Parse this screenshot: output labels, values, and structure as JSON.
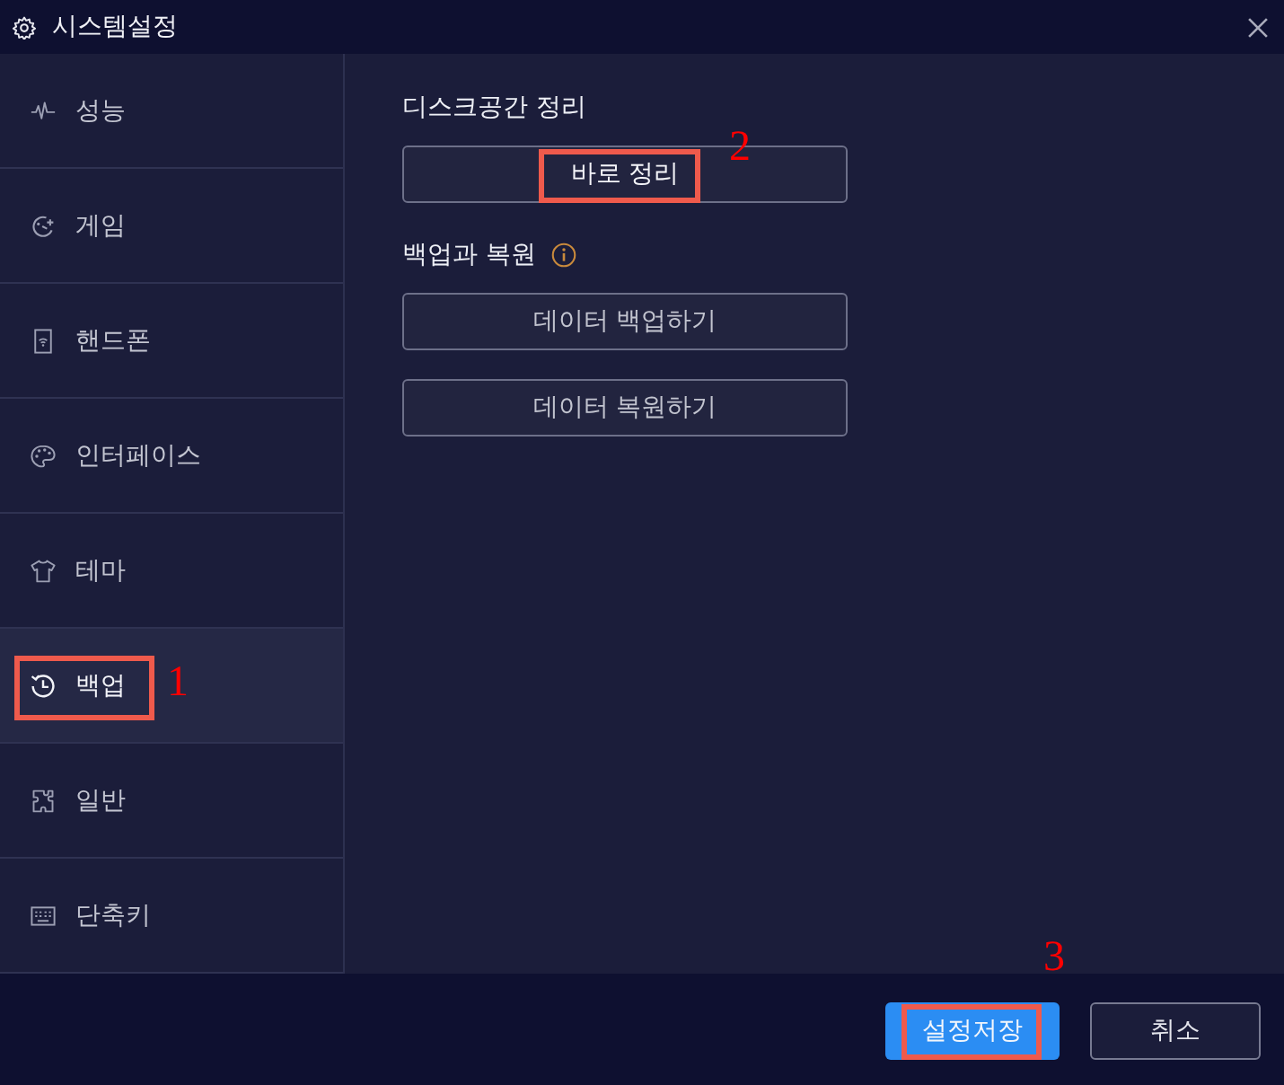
{
  "window": {
    "title": "시스템설정"
  },
  "sidebar": {
    "items": [
      {
        "label": "성능",
        "selected": false
      },
      {
        "label": "게임",
        "selected": false
      },
      {
        "label": "핸드폰",
        "selected": false
      },
      {
        "label": "인터페이스",
        "selected": false
      },
      {
        "label": "테마",
        "selected": false
      },
      {
        "label": "백업",
        "selected": true,
        "callout": "1"
      },
      {
        "label": "일반",
        "selected": false
      },
      {
        "label": "단축키",
        "selected": false
      }
    ]
  },
  "content": {
    "sections": [
      {
        "heading": "디스크공간 정리",
        "buttons": [
          {
            "label": "바로 정리",
            "callout": "2"
          }
        ]
      },
      {
        "heading": "백업과 복원",
        "info": true,
        "buttons": [
          {
            "label": "데이터 백업하기"
          },
          {
            "label": "데이터 복원하기"
          }
        ]
      }
    ]
  },
  "footer": {
    "buttons": [
      {
        "label": "설정저장",
        "kind": "primary",
        "callout": "3"
      },
      {
        "label": "취소",
        "kind": "secondary"
      }
    ]
  }
}
